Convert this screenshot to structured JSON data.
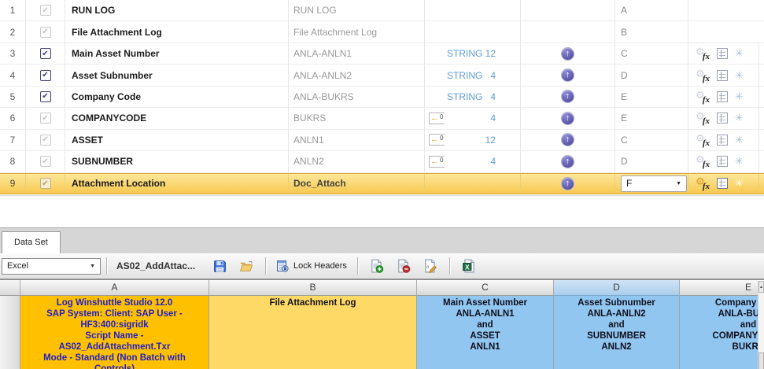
{
  "mapper": {
    "ext_zero": "0",
    "rows": [
      {
        "num": "1",
        "checkbox": "disabled",
        "name": "RUN LOG",
        "field": "RUN LOG",
        "type_label": "",
        "ext_marker": false,
        "length": "",
        "upload": false,
        "letter": "A",
        "letter_dropdown": false,
        "actions": false,
        "selected": false
      },
      {
        "num": "2",
        "checkbox": "disabled",
        "name": "File Attachment Log",
        "field": "File Attachment Log",
        "type_label": "",
        "ext_marker": false,
        "length": "",
        "upload": false,
        "letter": "B",
        "letter_dropdown": false,
        "actions": false,
        "selected": false
      },
      {
        "num": "3",
        "checkbox": "active",
        "name": "Main Asset Number",
        "field": "ANLA-ANLN1",
        "type_label": "STRING",
        "ext_marker": false,
        "length": "12",
        "upload": true,
        "letter": "C",
        "letter_dropdown": false,
        "actions": true,
        "selected": false
      },
      {
        "num": "4",
        "checkbox": "active",
        "name": "Asset Subnumber",
        "field": "ANLA-ANLN2",
        "type_label": "STRING",
        "ext_marker": false,
        "length": "4",
        "upload": true,
        "letter": "D",
        "letter_dropdown": false,
        "actions": true,
        "selected": false
      },
      {
        "num": "5",
        "checkbox": "active",
        "name": "Company Code",
        "field": "ANLA-BUKRS",
        "type_label": "STRING",
        "ext_marker": false,
        "length": "4",
        "upload": true,
        "letter": "E",
        "letter_dropdown": false,
        "actions": true,
        "selected": false
      },
      {
        "num": "6",
        "checkbox": "disabled",
        "name": "COMPANYCODE",
        "field": "BUKRS",
        "type_label": "",
        "ext_marker": true,
        "length": "4",
        "upload": true,
        "letter": "E",
        "letter_dropdown": false,
        "actions": true,
        "selected": false
      },
      {
        "num": "7",
        "checkbox": "disabled",
        "name": "ASSET",
        "field": "ANLN1",
        "type_label": "",
        "ext_marker": true,
        "length": "12",
        "upload": true,
        "letter": "C",
        "letter_dropdown": false,
        "actions": true,
        "selected": false
      },
      {
        "num": "8",
        "checkbox": "disabled",
        "name": "SUBNUMBER",
        "field": "ANLN2",
        "type_label": "",
        "ext_marker": true,
        "length": "4",
        "upload": true,
        "letter": "D",
        "letter_dropdown": false,
        "actions": true,
        "selected": false
      },
      {
        "num": "9",
        "checkbox": "disabled",
        "name": "Attachment Location",
        "field": "Doc_Attach",
        "type_label": "",
        "ext_marker": false,
        "length": "",
        "upload": true,
        "letter": "F",
        "letter_dropdown": true,
        "actions": true,
        "selected": true
      }
    ]
  },
  "tabs": {
    "data_set": "Data Set"
  },
  "toolbar": {
    "source_type": "Excel",
    "script_name": "AS02_AddAttac...",
    "lock_headers": "Lock Headers"
  },
  "sheet": {
    "selected_column": "D",
    "columns": [
      {
        "label": "A",
        "cell": {
          "bg": "#FFC000",
          "fg": "#1E1ECC",
          "lines": [
            "Log Winshuttle Studio 12.0",
            "SAP System: Client: SAP User -",
            "HF3:400:sigridk",
            "Script Name  -",
            "AS02_AddAttachment.Txr",
            "Mode - Standard (Non Batch with",
            "Controls)"
          ]
        }
      },
      {
        "label": "B",
        "cell": {
          "bg": "#FFD966",
          "fg": "#14141E",
          "lines": [
            "File Attachment Log"
          ]
        }
      },
      {
        "label": "C",
        "cell": {
          "bg": "#91C6F1",
          "fg": "#10101C",
          "lines": [
            "Main Asset Number",
            "ANLA-ANLN1",
            "and",
            "ASSET",
            "ANLN1"
          ]
        }
      },
      {
        "label": "D",
        "cell": {
          "bg": "#91C6F1",
          "fg": "#10101C",
          "lines": [
            "Asset Subnumber",
            "ANLA-ANLN2",
            "and",
            "SUBNUMBER",
            "ANLN2"
          ]
        }
      },
      {
        "label": "E",
        "cell": {
          "bg": "#91C6F1",
          "fg": "#10101C",
          "lines": [
            "Company Code",
            "ANLA-BUKRS",
            "and",
            "COMPANYCODE",
            "BUKRS"
          ]
        }
      }
    ]
  },
  "icons": {
    "check": "✔",
    "upload_arrow": "↑",
    "ext_arrow": "←",
    "gear": "⚙",
    "fx": "fx",
    "asterisk": "✳",
    "dropdown_arrow": "▼",
    "combo_arrow": "▼",
    "scroll_up": "▲"
  },
  "colors": {
    "selected_row_top": "#FCE79C",
    "selected_row_bottom": "#F7C94E",
    "selected_row_border": "#DFA938",
    "type_text_blue": "#5E9CD3",
    "upload_purple": "#605CB8",
    "header_selected_blue": "#B8D8F2",
    "cell_gold": "#FFC000",
    "cell_light_gold": "#FFD966",
    "cell_blue": "#91C6F1"
  }
}
